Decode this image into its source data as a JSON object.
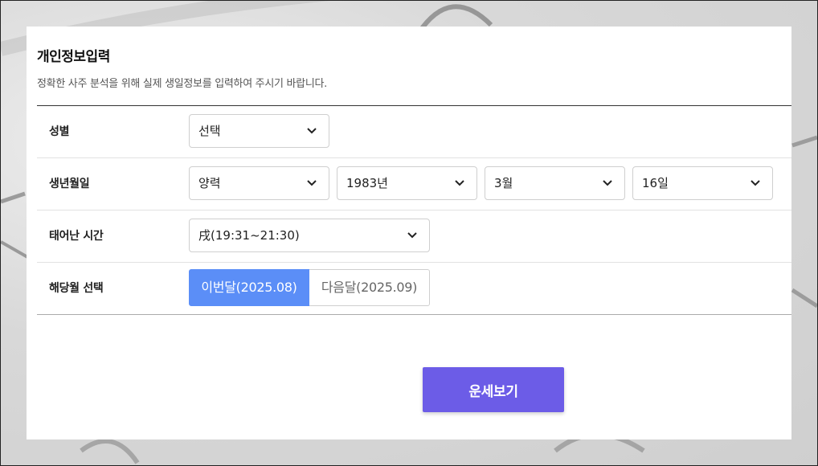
{
  "header": {
    "title": "개인정보입력",
    "subtitle": "정확한 사주 분석을 위해 실제 생일정보를 입력하여 주시기 바랍니다."
  },
  "form": {
    "gender": {
      "label": "성별",
      "value": "선택"
    },
    "birthdate": {
      "label": "생년월일",
      "calendar": "양력",
      "year": "1983년",
      "month": "3월",
      "day": "16일"
    },
    "birth_time": {
      "label": "태어난 시간",
      "value": "戌(19:31~21:30)"
    },
    "target_month": {
      "label": "해당월 선택",
      "options": [
        "이번달(2025.08)",
        "다음달(2025.09)"
      ],
      "selected": "이번달(2025.08)"
    }
  },
  "submit_label": "운세보기",
  "colors": {
    "accent_blue": "#5b8ef7",
    "accent_purple": "#6c5ce7"
  },
  "icons": [
    "chevron-down-icon"
  ]
}
